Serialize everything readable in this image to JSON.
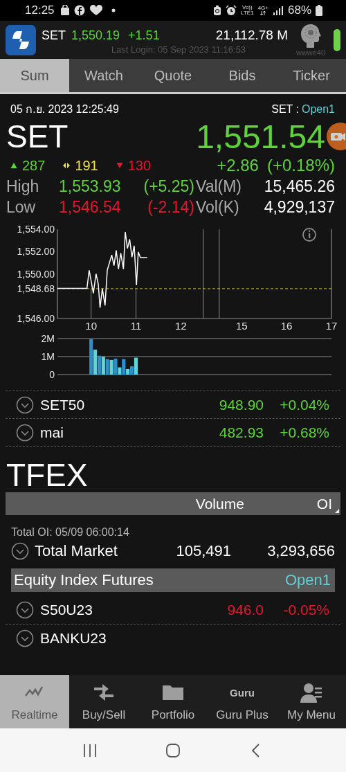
{
  "status_bar": {
    "time": "12:25",
    "volte": "Vo))",
    "lte": "LTE1",
    "data": "4G+",
    "battery": "68%"
  },
  "header": {
    "index": "SET",
    "value": "1,550.19",
    "change": "+1.51",
    "turnover": "21,112.78 M",
    "last_login": "Last Login: 05 Sep 2023 11:16:53",
    "user": "wwwe40"
  },
  "tabs": [
    {
      "label": "Sum",
      "selected": true
    },
    {
      "label": "Watch",
      "selected": false
    },
    {
      "label": "Quote",
      "selected": false
    },
    {
      "label": "Bids",
      "selected": false
    },
    {
      "label": "Ticker",
      "selected": false
    }
  ],
  "market": {
    "datetime": "05 ก.ย. 2023 12:25:49",
    "market_label": "SET :",
    "market_status": "Open1",
    "index": "SET",
    "last": "1,551.54",
    "advances": "287",
    "unchanged": "191",
    "declines": "130",
    "change": "+2.86",
    "percent_change": "(+0.18%)",
    "stats": [
      {
        "label": "High",
        "value": "1,553.93",
        "change": "(+5.25)",
        "color": "#5fd33a",
        "label_2": "Val(M)",
        "value_2": "15,465.26"
      },
      {
        "label": "Low",
        "value": "1,546.54",
        "change": "(-2.14)",
        "color": "#e5162f",
        "label_2": "Vol(K)",
        "value_2": "4,929,137"
      }
    ],
    "price_chart": {
      "chart_data": {
        "type": "line",
        "x": [
          9.25,
          9.906,
          9.957,
          10.05,
          10.11,
          10.16,
          10.2,
          10.25,
          10.31,
          10.36,
          10.46,
          10.51,
          10.56,
          10.61,
          10.66,
          10.72,
          10.76,
          10.81,
          10.86,
          10.91,
          10.96,
          11.01,
          11.05,
          11.1,
          11.25
        ],
        "series": [
          {
            "color": "#ffffff",
            "values": [
              1548.7,
              1548.7,
              1550.32,
              1548.26,
              1550.0,
              1549.08,
              1546.97,
              1548.67,
              1547.17,
              1550.32,
              1551.7,
              1550.73,
              1552.1,
              1550.42,
              1551.86,
              1550.42,
              1553.75,
              1552.27,
              1553.1,
              1551.5,
              1552.52,
              1548.98,
              1551.96,
              1551.45,
              1551.45
            ]
          }
        ],
        "xlim": [
          9.25,
          15.354
        ],
        "ylim": [
          1546,
          1554
        ],
        "xticks": [
          10,
          11,
          12
        ],
        "yticks": [
          {
            "value": 1546,
            "label": "1,546.00"
          },
          {
            "value": 1548.68,
            "label": "1,548.68"
          },
          {
            "value": 1550,
            "label": "1,550.00"
          },
          {
            "value": 1552,
            "label": "1,552.00"
          },
          {
            "value": 1554,
            "label": "1,554.00"
          }
        ],
        "ref_lines": [
          {
            "axis": "y",
            "value": 1548.68,
            "color": "#e8d83c"
          },
          {
            "axis": "x",
            "value": 10,
            "color": "#8a8a8a"
          },
          {
            "axis": "x",
            "value": 11,
            "color": "#8a8a8a"
          },
          {
            "axis": "x",
            "value": 12.5,
            "color": "#8a8a8a"
          },
          {
            "axis": "x",
            "value": 12.854,
            "color": "#8a8a8a"
          }
        ]
      },
      "afternoon_ticks": [
        "15",
        "16",
        "17"
      ]
    },
    "volume_chart": {
      "chart_data": {
        "type": "bar",
        "series": [
          {
            "color": "#2a8fcc",
            "values": [
              1970000,
              null,
              1050000,
              null,
              860000,
              null,
              890000,
              null,
              860000,
              null,
              460000,
              null
            ]
          },
          {
            "color": "#5ad6dc",
            "values": [
              null,
              1390000,
              null,
              1000000,
              null,
              810000,
              null,
              400000,
              null,
              310000,
              null,
              940000
            ]
          }
        ],
        "ylim": [
          0,
          2000000
        ],
        "yticks": [
          {
            "value": 0,
            "label": "0"
          },
          {
            "value": 1000000,
            "label": "1M"
          },
          {
            "value": 2000000,
            "label": "2M"
          }
        ],
        "stacked": true
      }
    }
  },
  "indices": [
    {
      "name": "SET50",
      "value": "948.90",
      "change": "+0.04%",
      "color": "#5fd33a"
    },
    {
      "name": "mai",
      "value": "482.93",
      "change": "+0.68%",
      "color": "#5fd33a"
    }
  ],
  "tfex": {
    "title": "TFEX",
    "columns": [
      "Volume",
      "OI"
    ],
    "total_oi": "Total OI: 05/09 06:00:14",
    "total": {
      "name": "Total Market",
      "volume": "105,491",
      "oi": "3,293,656"
    },
    "group": {
      "name": "Equity Index Futures",
      "status": "Open1"
    },
    "contracts": [
      {
        "name": "S50U23",
        "value": "946.0",
        "change": "-0.05%",
        "color": "#e5162f"
      },
      {
        "name": "BANKU23"
      }
    ]
  },
  "bottom_nav": [
    {
      "label": "Realtime",
      "kind": "chart",
      "selected": true
    },
    {
      "label": "Buy/Sell",
      "kind": "swap",
      "selected": false
    },
    {
      "label": "Portfolio",
      "kind": "folder",
      "selected": false
    },
    {
      "label": "Guru Plus",
      "kind": "logo",
      "logo_text": "Guru",
      "selected": false
    },
    {
      "label": "My Menu",
      "kind": "person",
      "selected": false
    }
  ]
}
